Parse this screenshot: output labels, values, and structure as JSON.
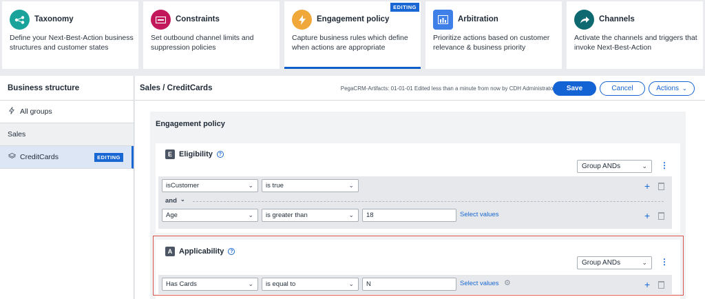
{
  "colors": {
    "accent": "#1463d4",
    "taxonomy": "#1aa39a",
    "constraints": "#c2185b",
    "engagement": "#f0a83b",
    "arbitration": "#3f7fe8",
    "channels": "#0e6a70",
    "highlight_box": "#d9534f"
  },
  "cards": [
    {
      "title": "Taxonomy",
      "desc": "Define your Next-Best-Action business structures and customer states",
      "icon": "taxonomy-icon"
    },
    {
      "title": "Constraints",
      "desc": "Set outbound channel limits and suppression policies",
      "icon": "constraints-icon"
    },
    {
      "title": "Engagement policy",
      "desc": "Capture business rules which define when actions are appropriate",
      "icon": "lightning-icon",
      "tag": "EDITING"
    },
    {
      "title": "Arbitration",
      "desc": "Prioritize actions based on customer relevance & business priority",
      "icon": "arbitration-icon"
    },
    {
      "title": "Channels",
      "desc": "Activate the channels and triggers that invoke Next-Best-Action",
      "icon": "share-arrow-icon"
    }
  ],
  "left": {
    "title": "Business structure",
    "items": [
      {
        "label": "All groups"
      },
      {
        "label": "Sales"
      },
      {
        "label": "CreditCards",
        "badge": "EDITING"
      }
    ]
  },
  "header": {
    "breadcrumb": "Sales / CreditCards",
    "meta": "PegaCRM-Artifacts: 01-01-01   Edited less than a minute from now by CDH Administrator",
    "save": "Save",
    "cancel": "Cancel",
    "actions": "Actions"
  },
  "policy": {
    "title": "Engagement policy",
    "eligibility": {
      "letter": "E",
      "title": "Eligibility",
      "group": "Group ANDs",
      "rows": [
        {
          "field": "isCustomer",
          "op": "is true"
        },
        {
          "field": "Age",
          "op": "is greater than",
          "value": "18",
          "link": "Select values"
        }
      ],
      "joiner": "and"
    },
    "applicability": {
      "letter": "A",
      "title": "Applicability",
      "group": "Group ANDs",
      "rows": [
        {
          "field": "Has Cards",
          "op": "is equal to",
          "value": "N",
          "link": "Select values"
        }
      ]
    }
  }
}
